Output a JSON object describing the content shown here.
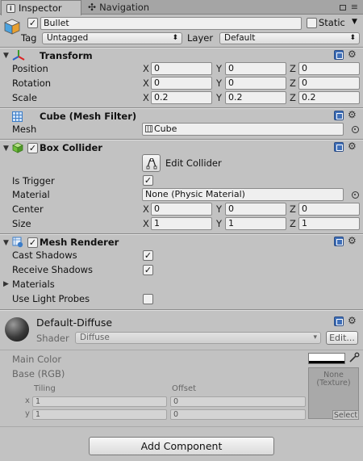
{
  "tabs": [
    {
      "label": "Inspector"
    },
    {
      "label": "Navigation"
    }
  ],
  "tabbar_icons": [
    "≡"
  ],
  "gameobject": {
    "name": "Bullet",
    "static_label": "Static",
    "tag_label": "Tag",
    "tag_value": "Untagged",
    "layer_label": "Layer",
    "layer_value": "Default"
  },
  "transform": {
    "title": "Transform",
    "rows": [
      {
        "label": "Position",
        "x": "0",
        "y": "0",
        "z": "0"
      },
      {
        "label": "Rotation",
        "x": "0",
        "y": "0",
        "z": "0"
      },
      {
        "label": "Scale",
        "x": "0.2",
        "y": "0.2",
        "z": "0.2"
      }
    ]
  },
  "mesh_filter": {
    "title": "Cube (Mesh Filter)",
    "mesh_label": "Mesh",
    "mesh_value": "Cube"
  },
  "box_collider": {
    "title": "Box Collider",
    "edit_label": "Edit Collider",
    "is_trigger_label": "Is Trigger",
    "is_trigger": true,
    "material_label": "Material",
    "material_value": "None (Physic Material)",
    "center_label": "Center",
    "center": {
      "x": "0",
      "y": "0",
      "z": "0"
    },
    "size_label": "Size",
    "size": {
      "x": "1",
      "y": "1",
      "z": "1"
    }
  },
  "mesh_renderer": {
    "title": "Mesh Renderer",
    "cast_shadows_label": "Cast Shadows",
    "cast_shadows": true,
    "receive_shadows_label": "Receive Shadows",
    "receive_shadows": true,
    "materials_label": "Materials",
    "light_probes_label": "Use Light Probes",
    "light_probes": false
  },
  "material": {
    "name": "Default-Diffuse",
    "shader_label": "Shader",
    "shader_value": "Diffuse",
    "edit_button": "Edit...",
    "main_color_label": "Main Color",
    "base_label": "Base (RGB)",
    "tiling_label": "Tiling",
    "offset_label": "Offset",
    "x_label": "x",
    "y_label": "y",
    "tiling_x": "1",
    "tiling_y": "1",
    "offset_x": "0",
    "offset_y": "0",
    "texture_none": "None",
    "texture_type": "(Texture)",
    "select_label": "Select"
  },
  "add_component_label": "Add Component",
  "axis_labels": {
    "x": "X",
    "y": "Y",
    "z": "Z"
  }
}
